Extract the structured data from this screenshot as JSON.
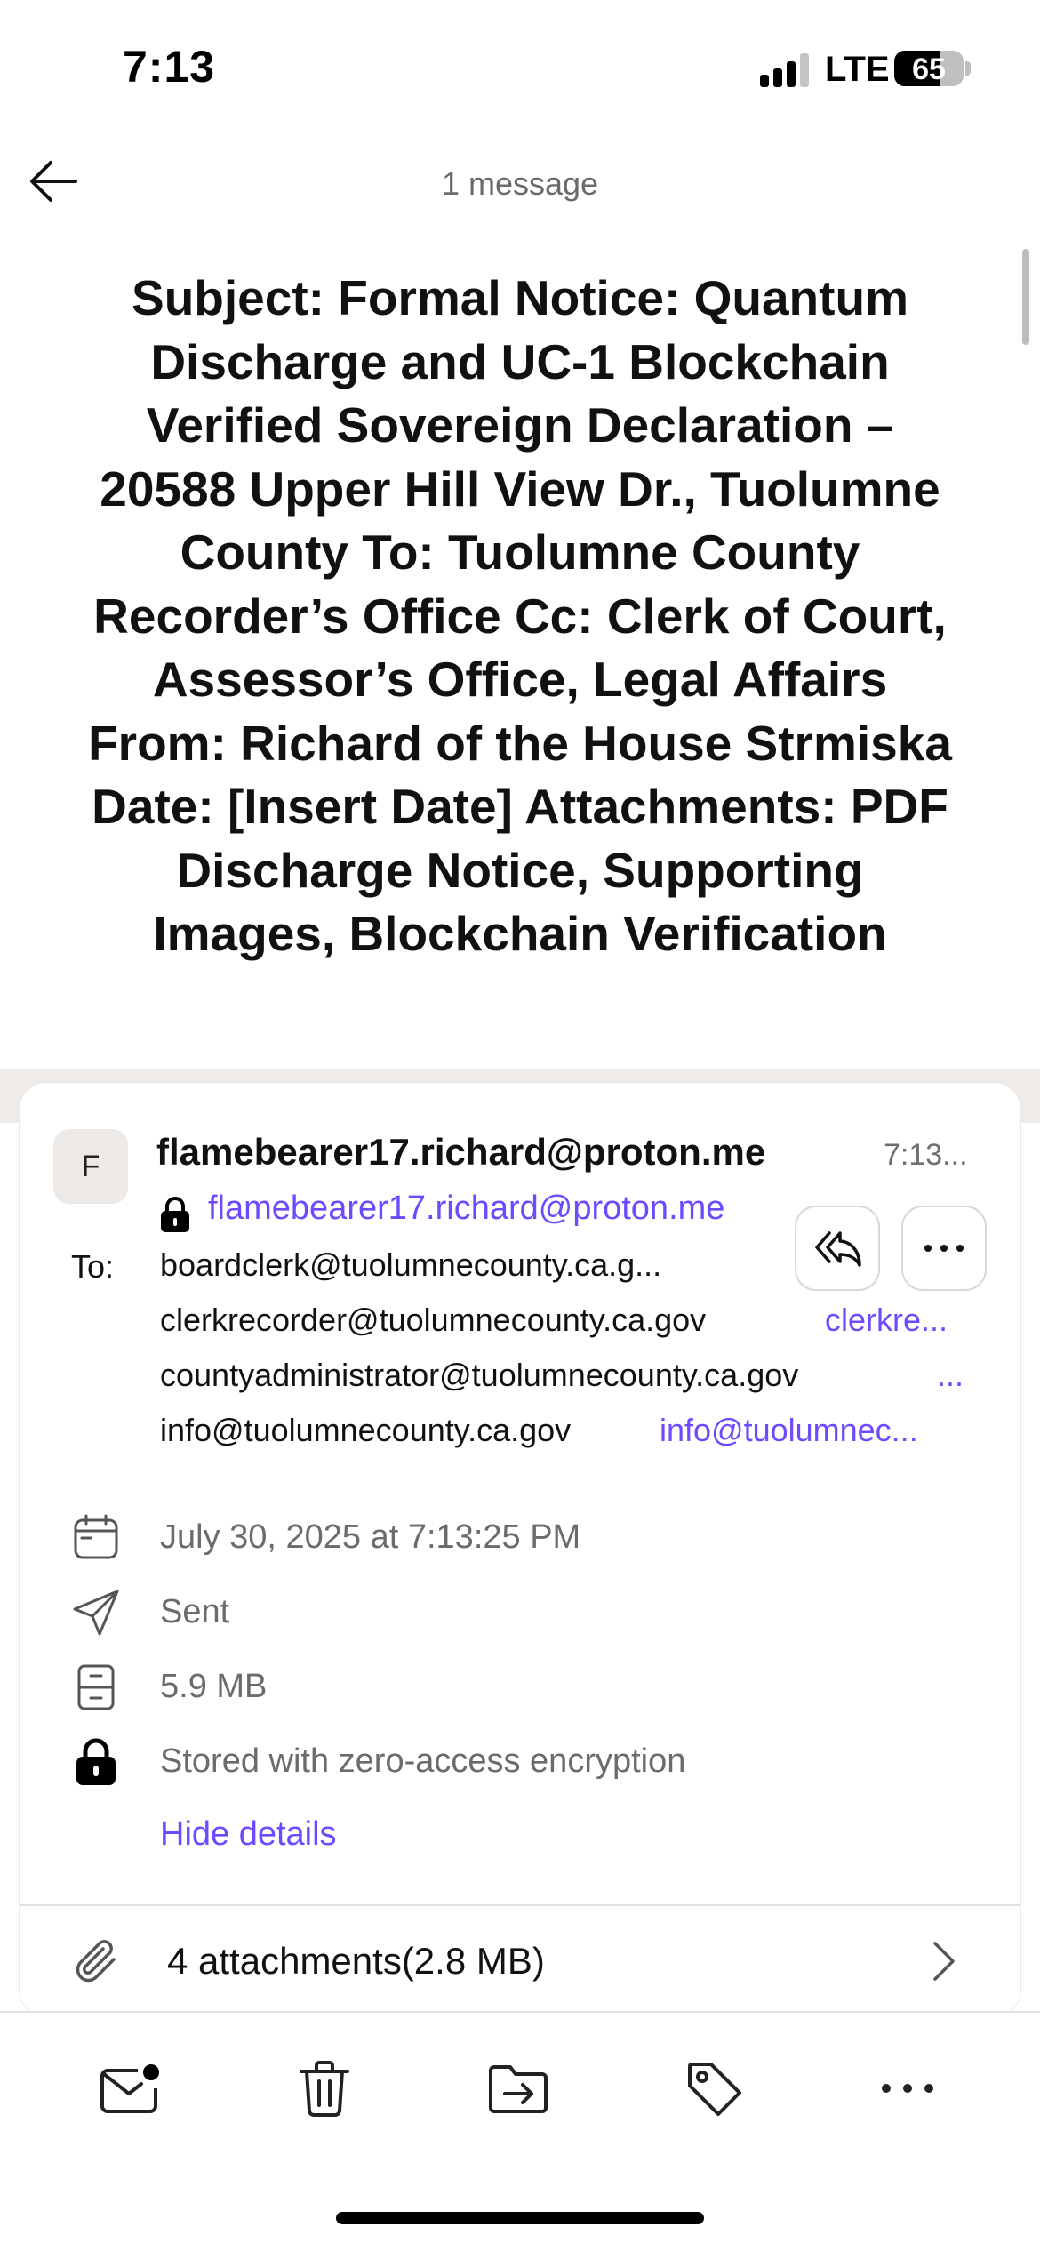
{
  "status_bar": {
    "time": "7:13",
    "network": "LTE",
    "battery_percent": "65",
    "battery_level": 0.65,
    "signal_bars_active": 3
  },
  "nav": {
    "back_icon": "arrow-left-icon",
    "message_count": "1 message"
  },
  "subject": "Subject: Formal Notice: Quantum Discharge and UC-1 Blockchain Verified Sovereign Declaration – 20588 Upper Hill View Dr., Tuolumne County  To: Tuolumne County Recorder’s Office Cc: Clerk of Court, Assessor’s Office, Legal Affairs From: Richard of the House Strmiska Date: [Insert Date] Attachments: PDF Discharge Notice, Supporting Images, Blockchain Verification",
  "message": {
    "avatar_initial": "F",
    "sender_name": "flamebearer17.richard@proton.me",
    "time": "7:13...",
    "sender_email": "flamebearer17.richard@proton.me",
    "to_label": "To:",
    "recipients": [
      {
        "address": "boardclerk@tuolumnecounty.ca.g...",
        "extra": ""
      },
      {
        "address": "clerkrecorder@tuolumnecounty.ca.gov",
        "extra": "clerkre..."
      },
      {
        "address": "countyadministrator@tuolumnecounty.ca.gov",
        "extra": "..."
      },
      {
        "address": "info@tuolumnecounty.ca.gov",
        "extra": "info@tuolumnec..."
      }
    ],
    "details": {
      "date": "July 30, 2025 at 7:13:25 PM",
      "folder": "Sent",
      "size": "5.9 MB",
      "encryption": "Stored with zero-access encryption"
    },
    "hide_details": "Hide details",
    "attachments": "4 attachments(2.8 MB)"
  },
  "colors": {
    "accent": "#6d4aff",
    "secondary_text": "#6b6b6b",
    "band": "#efebe8"
  },
  "toolbar": {
    "icons": [
      "mark-unread-icon",
      "trash-icon",
      "move-to-folder-icon",
      "label-icon",
      "more-icon"
    ]
  }
}
